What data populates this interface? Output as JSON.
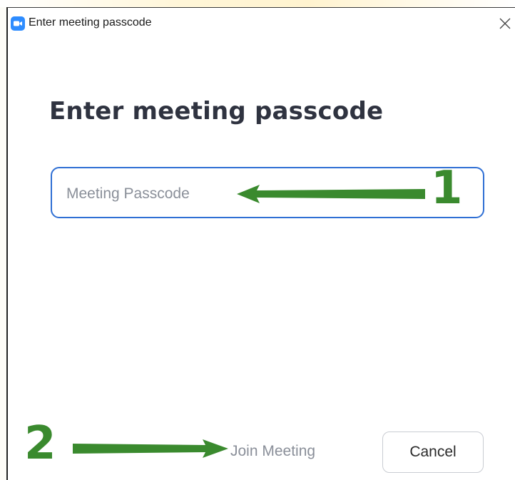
{
  "window": {
    "title": "Enter meeting passcode",
    "app_icon": "zoom-camera-icon",
    "close_icon": "close-icon"
  },
  "dialog": {
    "heading": "Enter meeting passcode",
    "passcode_input": {
      "placeholder": "Meeting Passcode",
      "value": ""
    },
    "join_button_label": "Join Meeting",
    "cancel_button_label": "Cancel"
  },
  "annotations": {
    "step_1": "1",
    "step_2": "2",
    "arrow_color": "#3a8a2e"
  },
  "colors": {
    "accent": "#2d8cff",
    "field_border": "#2f6fd4",
    "heading": "#2f3340"
  }
}
